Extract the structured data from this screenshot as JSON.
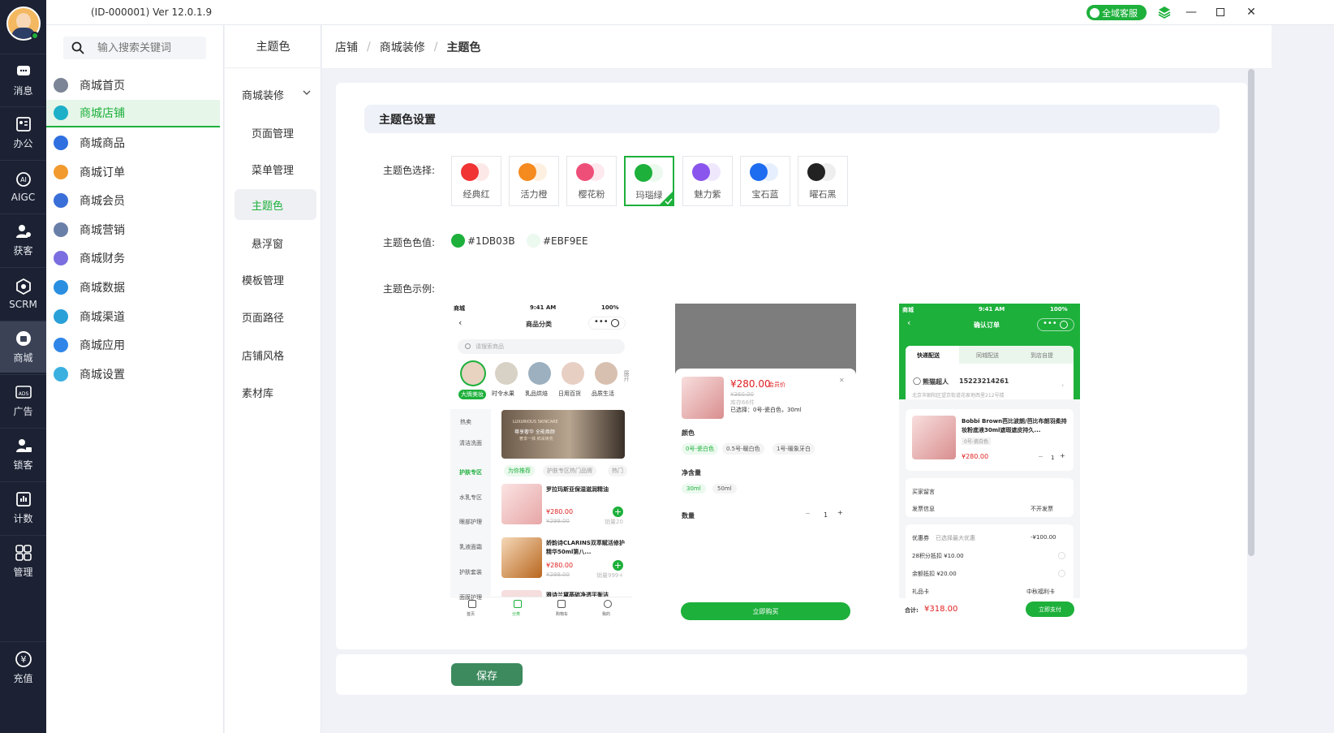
{
  "app": {
    "version": "(ID-000001)  Ver 12.0.1.9",
    "service_label": "全域客服"
  },
  "rail": [
    {
      "label": "消息",
      "icon": "message-icon"
    },
    {
      "label": "办公",
      "icon": "office-icon"
    },
    {
      "label": "AIGC",
      "icon": "ai-icon"
    },
    {
      "label": "获客",
      "icon": "acquire-icon"
    },
    {
      "label": "SCRM",
      "icon": "scrm-icon"
    },
    {
      "label": "商城",
      "icon": "mall-icon"
    },
    {
      "label": "广告",
      "icon": "ads-icon"
    },
    {
      "label": "锁客",
      "icon": "lock-customer-icon"
    },
    {
      "label": "计数",
      "icon": "count-icon"
    },
    {
      "label": "管理",
      "icon": "grid-icon"
    },
    {
      "label": "充值",
      "icon": "recharge-icon"
    }
  ],
  "menu": {
    "search_placeholder": "输入搜索关键词",
    "items": [
      {
        "label": "商城首页",
        "icon": "home-icon",
        "color": "#7b8596"
      },
      {
        "label": "商城店铺",
        "icon": "shop-icon",
        "color": "#1db0c8"
      },
      {
        "label": "商城商品",
        "icon": "bag-icon",
        "color": "#2f6fe0"
      },
      {
        "label": "商城订单",
        "icon": "order-icon",
        "color": "#f29a2e"
      },
      {
        "label": "商城会员",
        "icon": "member-icon",
        "color": "#3a6fd8"
      },
      {
        "label": "商城营销",
        "icon": "marketing-icon",
        "color": "#6a7fa8"
      },
      {
        "label": "商城财务",
        "icon": "finance-icon",
        "color": "#7a6ee0"
      },
      {
        "label": "商城数据",
        "icon": "data-icon",
        "color": "#2a8fe0"
      },
      {
        "label": "商城渠道",
        "icon": "channel-icon",
        "color": "#2aa0d8"
      },
      {
        "label": "商城应用",
        "icon": "app-icon",
        "color": "#2f86e8"
      },
      {
        "label": "商城设置",
        "icon": "settings-icon",
        "color": "#3ab0e0"
      }
    ]
  },
  "submenu": {
    "head": "主题色",
    "group": "商城装修",
    "children": [
      "页面管理",
      "菜单管理",
      "主题色",
      "悬浮窗"
    ],
    "others": [
      "模板管理",
      "页面路径",
      "店铺风格",
      "素材库"
    ]
  },
  "breadcrumb": [
    "店铺",
    "商城装修",
    "主题色"
  ],
  "theme": {
    "section_title": "主题色设置",
    "select_label": "主题色选择:",
    "value_label": "主题色色值:",
    "example_label": "主题色示例:",
    "swatches": [
      {
        "name": "经典红",
        "main": "#f03333",
        "light": "#fde8e8"
      },
      {
        "name": "活力橙",
        "main": "#f58a1f",
        "light": "#fdf0e1"
      },
      {
        "name": "樱花粉",
        "main": "#ee4f78",
        "light": "#fde9ee"
      },
      {
        "name": "玛瑙绿",
        "main": "#1DB03B",
        "light": "#EBF9EE",
        "selected": true
      },
      {
        "name": "魅力紫",
        "main": "#8a55ec",
        "light": "#efe8fd"
      },
      {
        "name": "宝石蓝",
        "main": "#1e6cf0",
        "light": "#e6effd"
      },
      {
        "name": "曜石黑",
        "main": "#222222",
        "light": "#eeeeee"
      }
    ],
    "value_main": "#1DB03B",
    "value_light": "#EBF9EE"
  },
  "phone1": {
    "time": "9:41 AM",
    "carrier": "商城",
    "battery": "100%",
    "title": "商品分类",
    "search": "请搜索商品",
    "cats": [
      "大牌美妆",
      "时令水果",
      "乳品烘焙",
      "日用百货",
      "品质生活"
    ],
    "expand": "展开",
    "side": [
      "热卖",
      "清洁洗面",
      "护肤专区",
      "水乳专区",
      "眼部护理",
      "乳液面霜",
      "护肤套装",
      "面膜护理"
    ],
    "banner_line1": "LUXURIOUS SKINCARE",
    "banner_line2": "尊享奢华 全能焕颜",
    "banner_line3": "奢享一抹 鲜采焕亮",
    "tabs": [
      "为你推荐",
      "护肤专区热门品牌",
      "热门"
    ],
    "p1_name": "罗拉玛斯亚保湿滋润精油",
    "p1_price": "¥280.00",
    "p1_old": "¥299.00",
    "p1_sales": "销量20",
    "p2_name": "娇韵诗CLARINS双萃赋活修护精华50ml第八...",
    "p2_price": "¥280.00",
    "p2_old": "¥299.00",
    "p2_sales": "销量999+",
    "p3_name": "雅诗兰黛基础净透平衡洁",
    "nav": [
      "首页",
      "分类",
      "购物车",
      "我的"
    ]
  },
  "phone2": {
    "price": "¥280.00",
    "tag": "会员价",
    "old": "¥360.00",
    "stock": "库存66件",
    "chosen": "已选择：0号-瓷白色，30ml",
    "color_label": "颜色",
    "colors": [
      "0号-瓷白色",
      "0.5号-暖白色",
      "1号-暖象牙白"
    ],
    "vol_label": "净含量",
    "vols": [
      "30ml",
      "50ml"
    ],
    "qty_label": "数量",
    "qty": "1",
    "buy": "立即购买"
  },
  "phone3": {
    "time": "9:41 AM",
    "carrier": "商城",
    "battery": "100%",
    "title": "确认订单",
    "tabs": [
      "快递配送",
      "同城配送",
      "到店自提"
    ],
    "name": "熊猫超人",
    "phone": "15223214261",
    "addr": "北京市朝阳区望京街道花家地西里212号楼",
    "prod": "Bobbi Brown芭比波朗/芭比布朗羽柔持妆粉底液30ml遮瑕遮皮持久...",
    "spec": "0号-瓷白色",
    "price": "¥280.00",
    "qty": "1",
    "remark": "买家留言",
    "invoice": "发票信息",
    "invoice_val": "不开发票",
    "coupon": "优惠券",
    "coupon_note": "已选择最大优惠",
    "coupon_val": "-¥100.00",
    "points": "28积分抵扣 ¥10.00",
    "balance": "余额抵扣 ¥20.00",
    "gift": "礼品卡",
    "gift_val": "中秋福利卡",
    "total_label": "合计:",
    "total": "¥318.00",
    "pay": "立即支付"
  },
  "save": "保存"
}
